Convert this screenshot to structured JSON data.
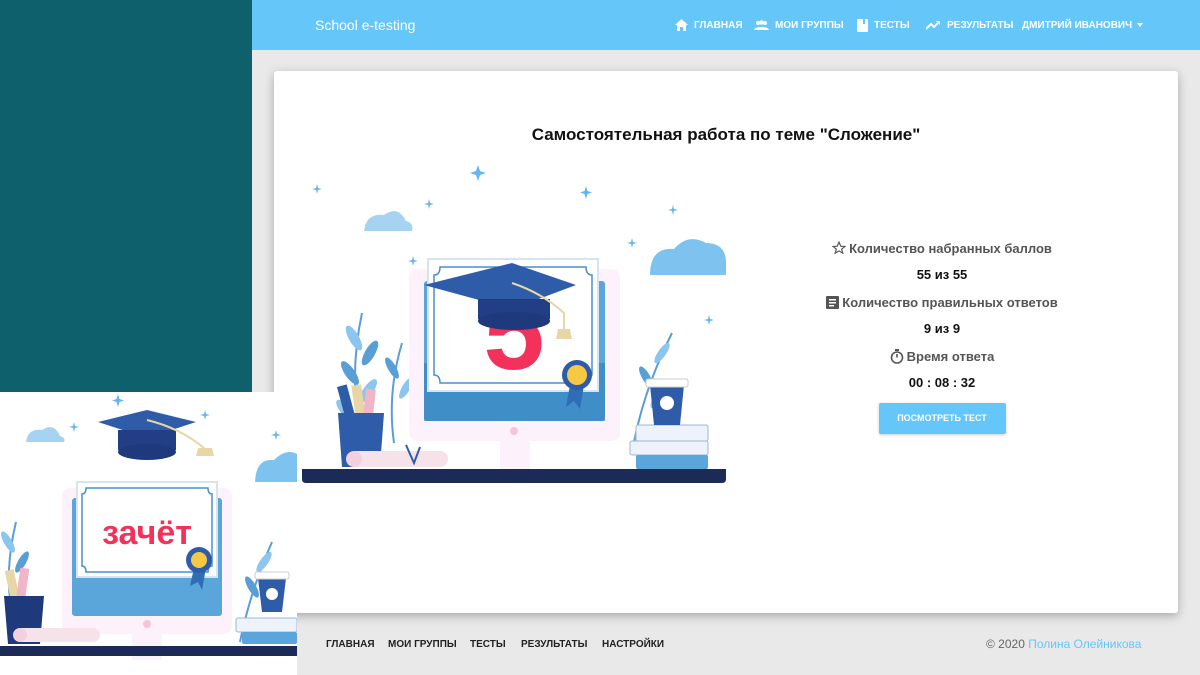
{
  "navbar": {
    "brand": "School e-testing",
    "items": [
      {
        "label": "ГЛАВНАЯ",
        "icon": "home-icon"
      },
      {
        "label": "МОИ ГРУППЫ",
        "icon": "groups-icon"
      },
      {
        "label": "ТЕСТЫ",
        "icon": "book-icon"
      },
      {
        "label": "РЕЗУЛЬТАТЫ",
        "icon": "trending-up-icon"
      }
    ],
    "user": "ДМИТРИЙ ИВАНОВИЧ"
  },
  "result": {
    "title": "Самостоятельная работа по теме \"Сложение\"",
    "grade": "5",
    "stats": [
      {
        "icon": "star-icon",
        "label": "Количество набранных баллов",
        "value": "55 из 55"
      },
      {
        "icon": "list-icon",
        "label": "Количество правильных ответов",
        "value": "9 из 9"
      },
      {
        "icon": "timer-icon",
        "label": "Время ответа",
        "value": "00 : 08 : 32"
      }
    ],
    "view_button": "ПОСМОТРЕТЬ ТЕСТ"
  },
  "overlay": {
    "grade_text": "зачёт"
  },
  "footer": {
    "links": [
      "ГЛАВНАЯ",
      "МОИ ГРУППЫ",
      "ТЕСТЫ",
      "РЕЗУЛЬТАТЫ",
      "НАСТРОЙКИ"
    ],
    "copyright": "© 2020",
    "author": "Полина Олейникова"
  },
  "colors": {
    "accent": "#64c6f9",
    "left_panel": "#0e606d",
    "grade": "#f2325a",
    "cap": "#2f5ca8"
  }
}
